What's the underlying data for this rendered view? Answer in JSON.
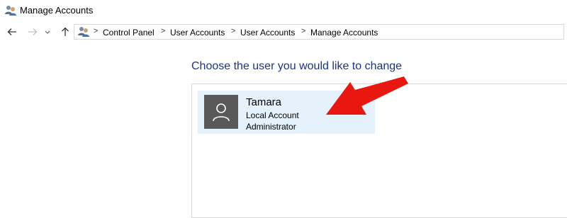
{
  "window": {
    "title": "Manage Accounts"
  },
  "nav": {
    "icons": [
      "back-arrow-icon",
      "forward-arrow-icon",
      "recent-locations-chevron-icon",
      "up-arrow-icon"
    ]
  },
  "address_bar": {
    "crumbs": [
      "Control Panel",
      "User Accounts",
      "User Accounts",
      "Manage Accounts"
    ],
    "separator": ">"
  },
  "main": {
    "heading": "Choose the user you would like to change",
    "accounts": [
      {
        "name": "Tamara",
        "type": "Local Account",
        "role": "Administrator"
      }
    ]
  },
  "colors": {
    "heading": "#1e3287",
    "tile_selected": "#e5f1fb",
    "avatar_bg": "#595959",
    "annotation_arrow": "#e8170f"
  }
}
